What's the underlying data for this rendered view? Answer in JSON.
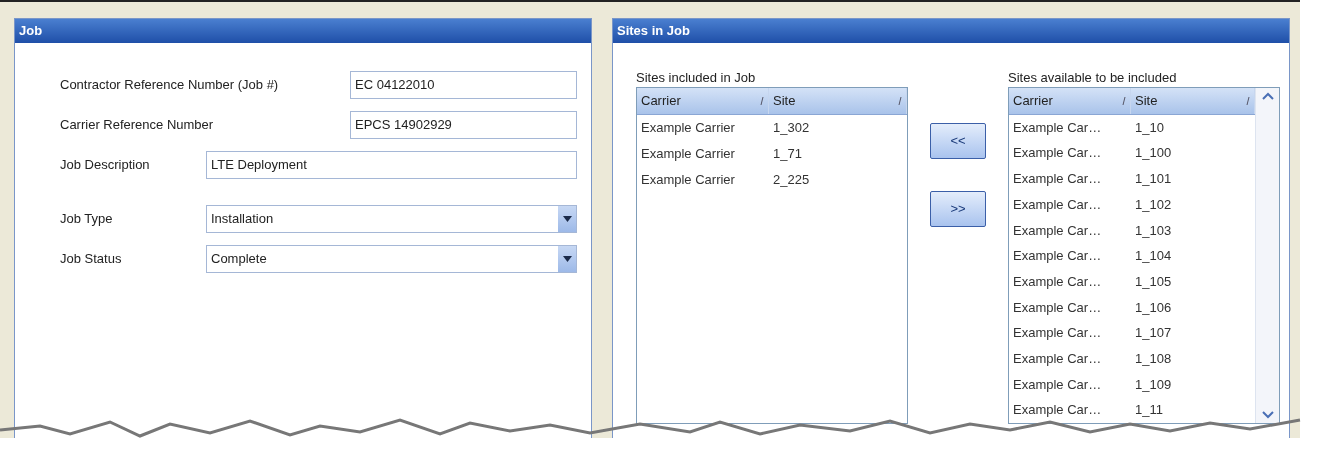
{
  "job_panel": {
    "title": "Job",
    "fields": [
      {
        "kind": "text",
        "label": "Contractor Reference Number (Job #)",
        "value": "EC 04122010"
      },
      {
        "kind": "text",
        "label": "Carrier Reference Number",
        "value": "EPCS 14902929"
      },
      {
        "kind": "text",
        "label": "Job Description",
        "value": "LTE Deployment"
      },
      {
        "kind": "dropdown",
        "label": "Job Type",
        "value": "Installation"
      },
      {
        "kind": "dropdown",
        "label": "Job Status",
        "value": "Complete"
      }
    ]
  },
  "sites_panel": {
    "title": "Sites in Job",
    "included": {
      "label": "Sites included in Job",
      "columns": [
        "Carrier",
        "Site"
      ],
      "rows": [
        [
          "Example Carrier",
          "1_302"
        ],
        [
          "Example Carrier",
          "1_71"
        ],
        [
          "Example Carrier",
          "2_225"
        ]
      ]
    },
    "buttons": [
      "<<",
      ">>"
    ],
    "available": {
      "label": "Sites available to be included",
      "columns": [
        "Carrier",
        "Site"
      ],
      "rows": [
        [
          "Example Car…",
          "1_10"
        ],
        [
          "Example Car…",
          "1_100"
        ],
        [
          "Example Car…",
          "1_101"
        ],
        [
          "Example Car…",
          "1_102"
        ],
        [
          "Example Car…",
          "1_103"
        ],
        [
          "Example Car…",
          "1_104"
        ],
        [
          "Example Car…",
          "1_105"
        ],
        [
          "Example Car…",
          "1_106"
        ],
        [
          "Example Car…",
          "1_107"
        ],
        [
          "Example Car…",
          "1_108"
        ],
        [
          "Example Car…",
          "1_109"
        ],
        [
          "Example Car…",
          "1_11"
        ]
      ]
    }
  }
}
